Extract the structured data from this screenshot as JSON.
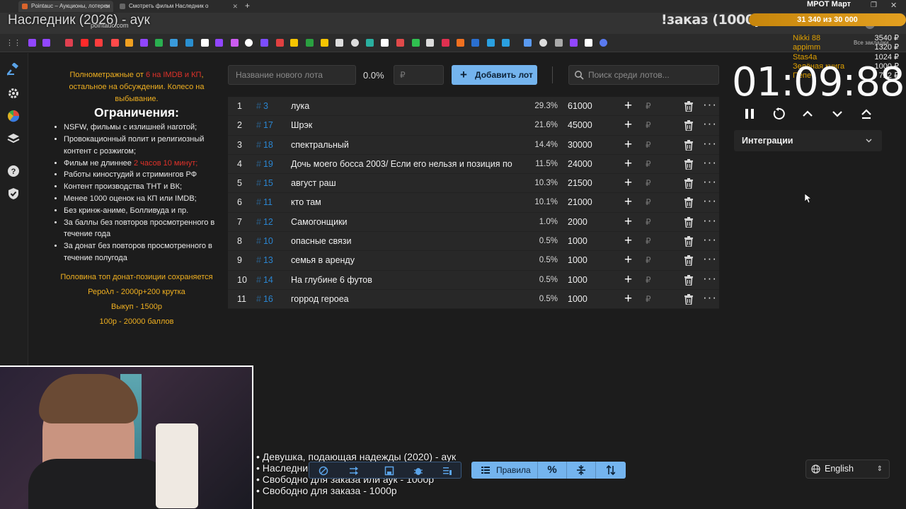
{
  "browser": {
    "tabs": [
      {
        "label": "Pointauc – Аукционы, лотереи",
        "active": true
      },
      {
        "label": "Смотреть фильм Наследник о",
        "active": false
      }
    ],
    "url": "pointauc.com",
    "bookmarks_label": "Все закладки"
  },
  "overlay": {
    "stream_title": "Наследник (2026) - аук",
    "order_label": "!заказ (1000р)",
    "goal_text": "31 340  из 30 000",
    "mrot_label": "МРОТ Март",
    "donors": [
      {
        "name": "Nikki 88",
        "amount": "3540 ₽"
      },
      {
        "name": "appimm",
        "amount": "1320 ₽"
      },
      {
        "name": "Stas4a",
        "amount": "1024 ₽"
      },
      {
        "name": "Зелёная книга",
        "amount": "1000 ₽"
      },
      {
        "name": "Пепе",
        "amount": "722 ₽"
      }
    ],
    "queue": [
      "• Девушка, подающая надежды (2020) - аук",
      "• Наследник (2026) - аук",
      "• Свободно для заказа или аук - 1000р",
      "• Свободно для заказа - 1000р"
    ]
  },
  "rules": {
    "intro_a": "Полнометражные от ",
    "intro_red": "6 на IMDB и КП",
    "intro_b": ", остальное на обсуждении. Колесо на выбывание.",
    "heading": "Ограничения:",
    "items": [
      "NSFW, фильмы с излишней наготой;",
      "Провокационный полит и религиозный контент с розжигом;",
      "Фильм не длиннее ",
      "Работы киностудий и стримингов РФ",
      "Контент производства ТНТ и ВК;",
      "Менее 1000 оценок на КП или IMDB;",
      "Без кринж-аниме, Болливуда и пр.",
      "За баллы без повторов просмотренного в течение года",
      "За донат без повторов просмотренного в течение полугода"
    ],
    "item3_red": "2 часов 10 минут;",
    "footer": [
      "Половина топ донат-позиции сохраняется",
      "Рерολл - 2000р+200 крутка",
      "Выкуп - 1500р",
      "100р - 20000 баллов"
    ]
  },
  "controls": {
    "lot_name_placeholder": "Название нового лота",
    "percent": "0.0%",
    "amount_placeholder": "₽",
    "add_lot_label": "Добавить лот",
    "search_placeholder": "Поиск среди лотов..."
  },
  "lots": [
    {
      "idx": "1",
      "num": "3",
      "name": "лука",
      "pct": "29.3%",
      "amount": "61000"
    },
    {
      "idx": "2",
      "num": "17",
      "name": "Шрэк",
      "pct": "21.6%",
      "amount": "45000"
    },
    {
      "idx": "3",
      "num": "18",
      "name": "спектральный",
      "pct": "14.4%",
      "amount": "30000"
    },
    {
      "idx": "4",
      "num": "19",
      "name": "Дочь моего босса 2003/ Если его нельзя и позиция по",
      "pct": "11.5%",
      "amount": "24000"
    },
    {
      "idx": "5",
      "num": "15",
      "name": "август раш",
      "pct": "10.3%",
      "amount": "21500"
    },
    {
      "idx": "6",
      "num": "11",
      "name": "кто там",
      "pct": "10.1%",
      "amount": "21000"
    },
    {
      "idx": "7",
      "num": "12",
      "name": "Самогонщики",
      "pct": "1.0%",
      "amount": "2000"
    },
    {
      "idx": "8",
      "num": "10",
      "name": "опасные связи",
      "pct": "0.5%",
      "amount": "1000"
    },
    {
      "idx": "9",
      "num": "13",
      "name": "семья в аренду",
      "pct": "0.5%",
      "amount": "1000"
    },
    {
      "idx": "10",
      "num": "14",
      "name": "На глубине 6 футов",
      "pct": "0.5%",
      "amount": "1000"
    },
    {
      "idx": "11",
      "num": "16",
      "name": "горрод героеа",
      "pct": "0.5%",
      "amount": "1000"
    }
  ],
  "lot_hash": "#",
  "plus_glyph": "+",
  "rub_glyph": "₽",
  "more_glyph": "···",
  "timer": {
    "value": "01:09:88",
    "integrations_label": "Интеграции"
  },
  "bottom": {
    "rules_label": "Правила",
    "percent_glyph": "%",
    "language": "English"
  },
  "colors": {
    "accent": "#74b4ee",
    "lot_number": "#2a85d0",
    "warning": "#f0b020",
    "danger": "#e0322a"
  }
}
